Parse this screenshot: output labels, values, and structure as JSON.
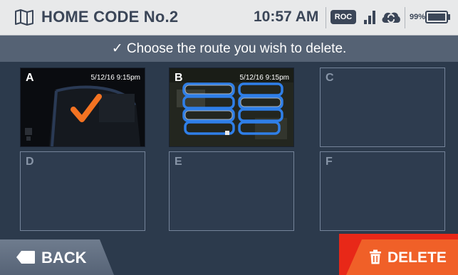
{
  "header": {
    "title": "HOME CODE No.2",
    "time": "10:57 AM",
    "roc_badge": "ROC",
    "battery_percent": "99%",
    "icons": [
      "map-icon",
      "signal-icon",
      "cloud-sync-icon",
      "battery-icon"
    ]
  },
  "instruction": "✓ Choose the route you wish to delete.",
  "routes": [
    {
      "letter": "A",
      "date": "5/12/16 9:15pm",
      "selected": true
    },
    {
      "letter": "B",
      "date": "5/12/16 9:15pm",
      "selected": false
    },
    {
      "letter": "C",
      "date": ""
    },
    {
      "letter": "D",
      "date": ""
    },
    {
      "letter": "E",
      "date": ""
    },
    {
      "letter": "F",
      "date": ""
    }
  ],
  "footer": {
    "back_label": "BACK",
    "delete_label": "DELETE"
  },
  "colors": {
    "background": "#2c3a4c",
    "header": "#e8e9ea",
    "accent_orange": "#f06028",
    "highlight_red": "#e82818",
    "route_blue": "#2f7fe8"
  }
}
